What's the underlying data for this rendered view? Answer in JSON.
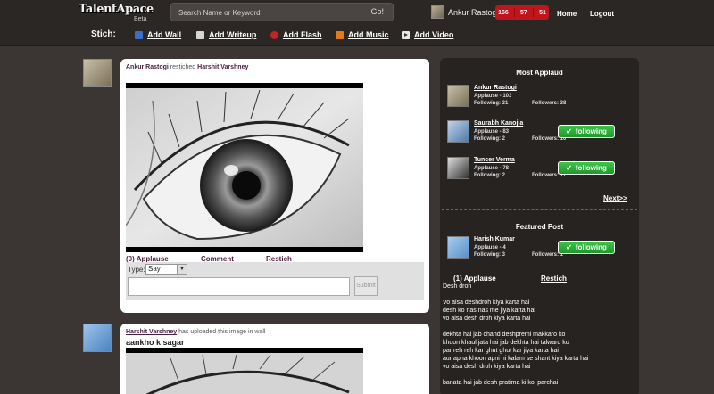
{
  "header": {
    "logo": "TalentApace",
    "beta": "Beta",
    "search_placeholder": "Search Name or Keyword",
    "go": "Go!",
    "user_name": "Ankur Rastogi",
    "counters": [
      "166",
      "57",
      "51"
    ],
    "nav": {
      "home": "Home",
      "logout": "Logout"
    }
  },
  "stich": {
    "label": "Stich:",
    "items": [
      {
        "label": "Add Wall",
        "icon": "wall-icon",
        "color": "#3b6fc4"
      },
      {
        "label": "Add Writeup",
        "icon": "writeup-icon",
        "color": "#d6d6d6"
      },
      {
        "label": "Add Flash",
        "icon": "flash-icon",
        "color": "#c42424"
      },
      {
        "label": "Add Music",
        "icon": "music-icon",
        "color": "#e07a1a"
      },
      {
        "label": "Add Video",
        "icon": "video-icon",
        "color": "#e8e8e8"
      }
    ]
  },
  "feed": [
    {
      "user": "Ankur Rastogi",
      "action": "restiched",
      "target": "Harshit Varshney",
      "actions": [
        "(0) Applause",
        "Comment",
        "Restich"
      ],
      "comment": {
        "type_label": "Type:",
        "type_value": "Say",
        "submit": "Submit"
      }
    },
    {
      "user": "Harshit Varshney",
      "action": "has uploaded this image in wall",
      "title": "aankho k sagar"
    }
  ],
  "sidebar": {
    "most_applaud_title": "Most Applaud",
    "people": [
      {
        "name": "Ankur Rastogi",
        "applause": "Applause - 103",
        "following": "Following: 31",
        "followers": "Followers: 38",
        "button": ""
      },
      {
        "name": "Saurabh Kanojia",
        "applause": "Applause - 83",
        "following": "Following: 2",
        "followers": "Followers: 10",
        "button": "following"
      },
      {
        "name": "Tuncer Verma",
        "applause": "Applause - 78",
        "following": "Following: 2",
        "followers": "Followers: 17",
        "button": "following"
      }
    ],
    "next": "Next>>",
    "featured_title": "Featured Post",
    "featured_person": {
      "name": "Harish Kumar",
      "applause": "Applause - 4",
      "following": "Following: 3",
      "followers": "Followers: 1",
      "button": "following"
    },
    "post_actions": [
      "(1) Applause",
      "Restich"
    ],
    "post_lines": [
      "Desh droh",
      "",
      "Vo aisa deshdroh kiya karta hai",
      "desh ko nas nas me jiya karta hai",
      "vo aisa desh droh kiya karta hai",
      "",
      "dekhta hai jab chand deshpremi makkaro ko",
      "khoon khaul jata hai jab dekhta hai talwaro ko",
      "par reh reh kar ghut ghut kar jiya karta hai",
      "aur apna khoon apni hi kalam se shant kiya karta hai",
      "vo aisa desh droh kiya karta hai",
      "",
      "banata hai jab desh pratima ki koi parchai"
    ]
  }
}
